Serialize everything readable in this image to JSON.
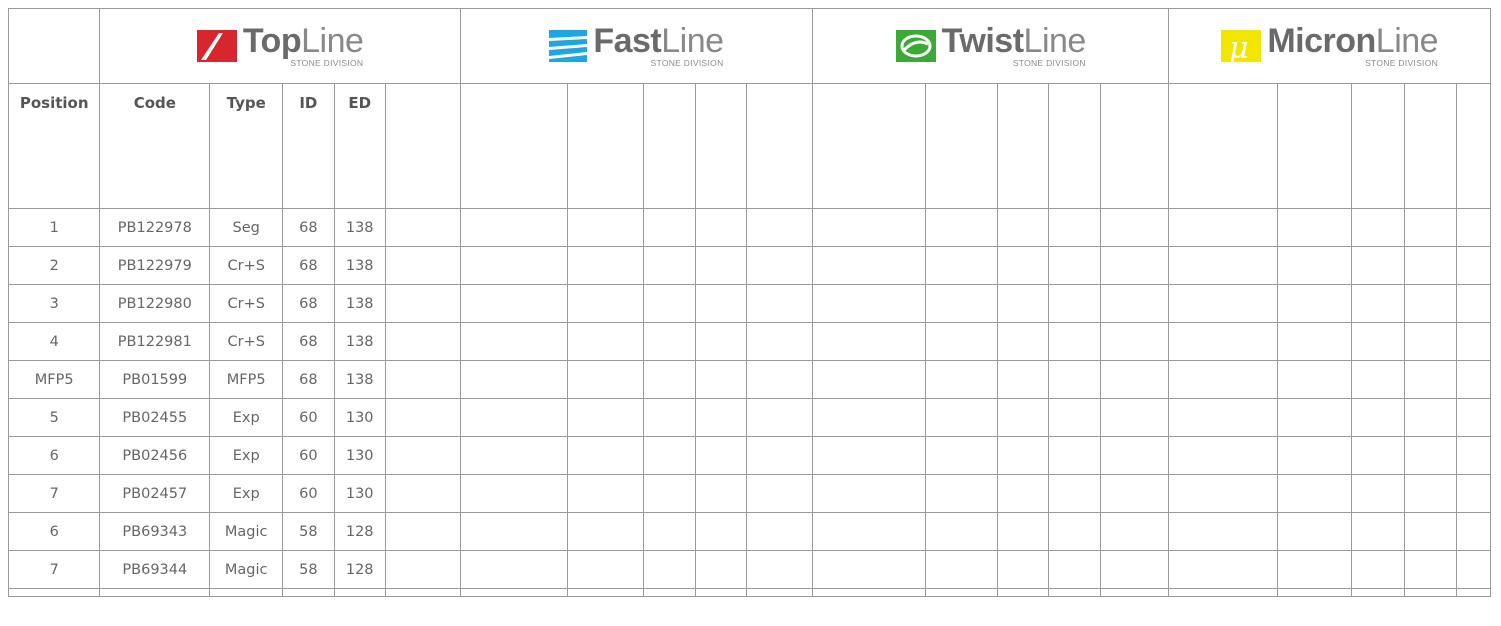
{
  "brands": [
    {
      "bold": "Top",
      "thin": "Line",
      "division": "STONE DIVISION",
      "color": "#d7262d"
    },
    {
      "bold": "Fast",
      "thin": "Line",
      "division": "STONE DIVISION",
      "color": "#1ea6e2"
    },
    {
      "bold": "Twist",
      "thin": "Line",
      "division": "STONE DIVISION",
      "color": "#3aa935"
    },
    {
      "bold": "Micron",
      "thin": "Line",
      "division": "STONE DIVISION",
      "color": "#f2e600"
    }
  ],
  "columns": [
    "Position",
    "Code",
    "Type",
    "ID",
    "ED"
  ],
  "rows": [
    [
      "1",
      "PB122978",
      "Seg",
      "68",
      "138"
    ],
    [
      "2",
      "PB122979",
      "Cr+S",
      "68",
      "138"
    ],
    [
      "3",
      "PB122980",
      "Cr+S",
      "68",
      "138"
    ],
    [
      "4",
      "PB122981",
      "Cr+S",
      "68",
      "138"
    ],
    [
      "MFP5",
      "PB01599",
      "MFP5",
      "68",
      "138"
    ],
    [
      "5",
      "PB02455",
      "Exp",
      "60",
      "130"
    ],
    [
      "6",
      "PB02456",
      "Exp",
      "60",
      "130"
    ],
    [
      "7",
      "PB02457",
      "Exp",
      "60",
      "130"
    ],
    [
      "6",
      "PB69343",
      "Magic",
      "58",
      "128"
    ],
    [
      "7",
      "PB69344",
      "Magic",
      "58",
      "128"
    ]
  ]
}
